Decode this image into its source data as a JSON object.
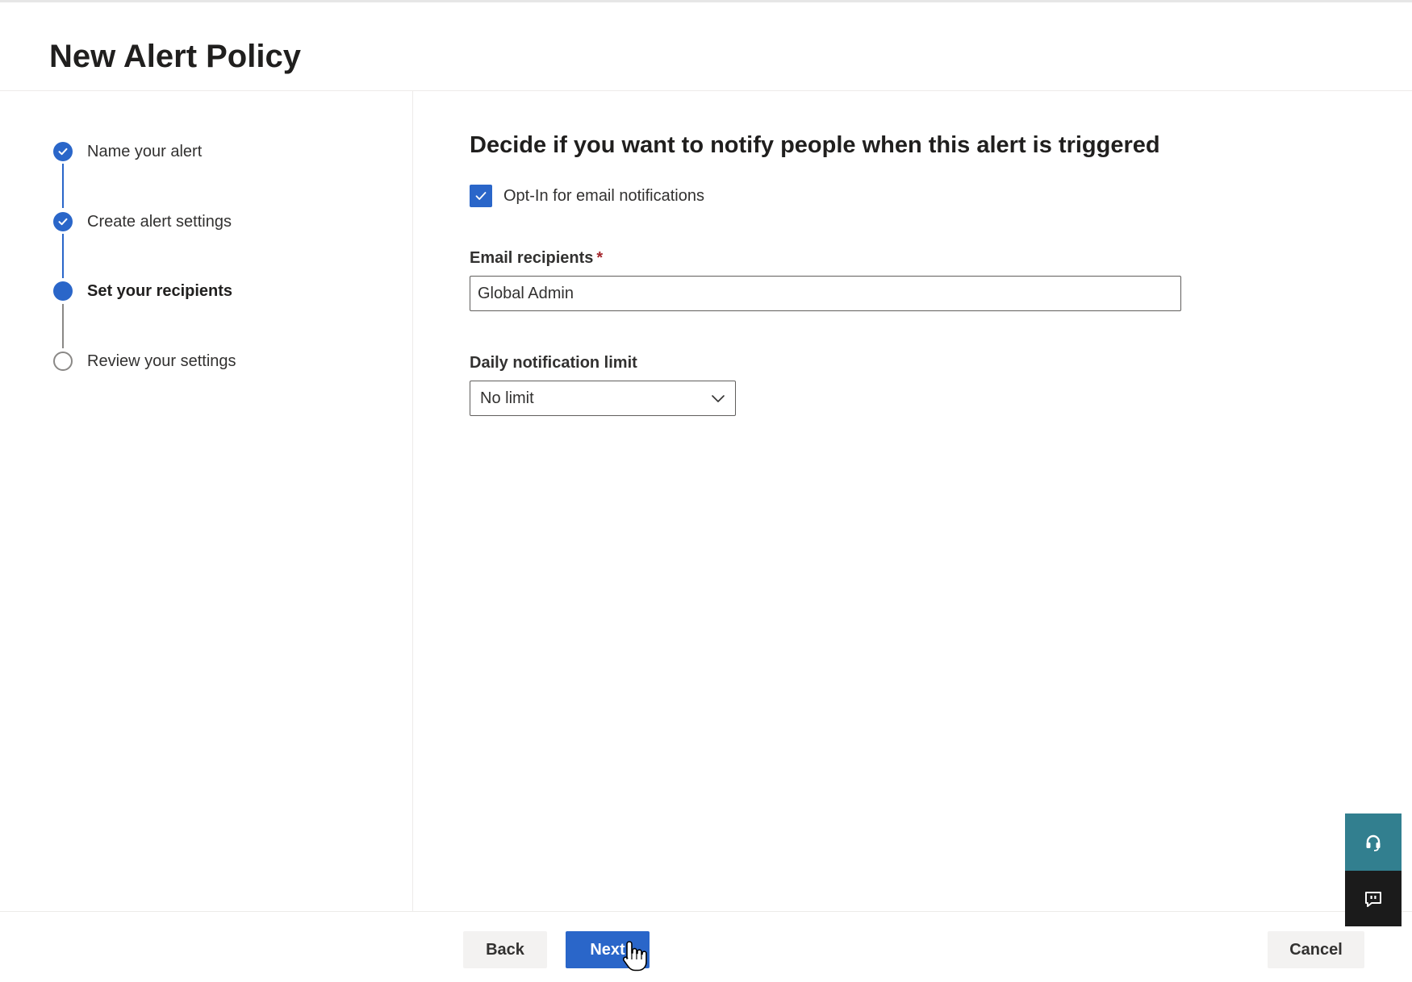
{
  "page": {
    "title": "New Alert Policy"
  },
  "wizard": {
    "steps": [
      {
        "label": "Name your alert",
        "state": "done"
      },
      {
        "label": "Create alert settings",
        "state": "done"
      },
      {
        "label": "Set your recipients",
        "state": "current"
      },
      {
        "label": "Review your settings",
        "state": "todo"
      }
    ]
  },
  "main": {
    "heading": "Decide if you want to notify people when this alert is triggered",
    "opt_in": {
      "label": "Opt-In for email notifications",
      "checked": true
    },
    "email_recipients": {
      "label": "Email recipients",
      "required_marker": "*",
      "value": "Global Admin"
    },
    "daily_limit": {
      "label": "Daily notification limit",
      "selected": "No limit"
    }
  },
  "footer": {
    "back_label": "Back",
    "next_label": "Next",
    "cancel_label": "Cancel"
  },
  "side_buttons": {
    "help_icon": "headset-icon",
    "feedback_icon": "feedback-icon"
  },
  "colors": {
    "accent": "#2a66c9",
    "help_teal": "#327f8f",
    "feedback_dark": "#1b1b1b"
  }
}
